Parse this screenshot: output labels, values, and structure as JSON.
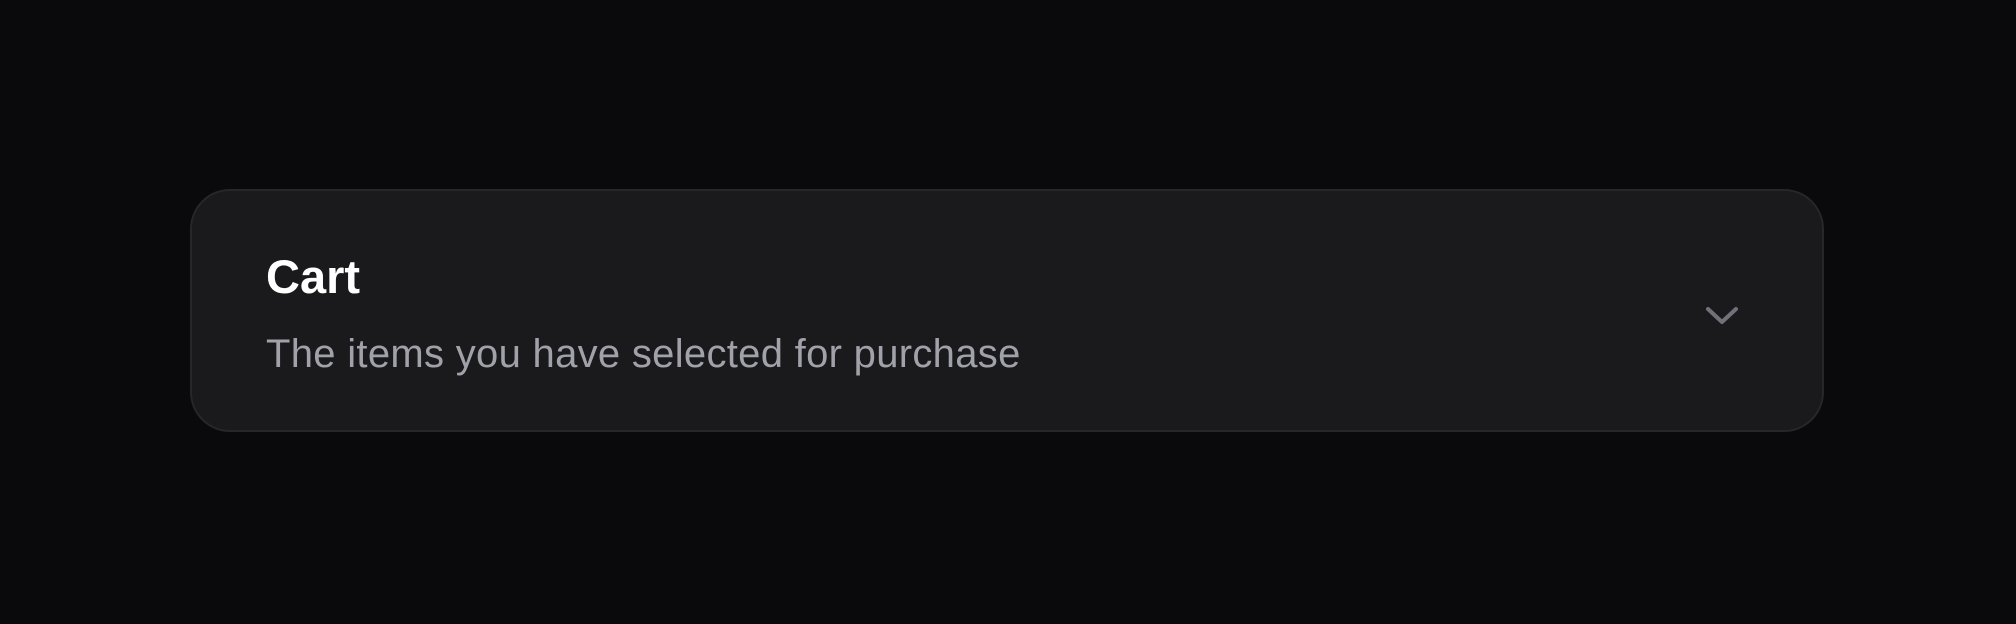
{
  "card": {
    "title": "Cart",
    "description": "The items you have selected for purchase",
    "toggle_icon": "chevron-down-icon",
    "expanded": false
  },
  "colors": {
    "background": "#0a0a0c",
    "card": "#1a1a1c",
    "title": "#ffffff",
    "description": "#a1a1aa",
    "icon": "#71717a"
  }
}
